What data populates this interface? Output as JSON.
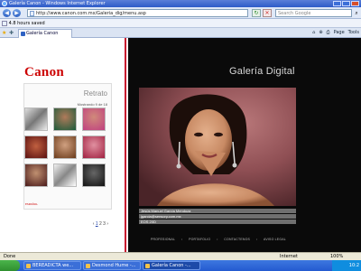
{
  "window": {
    "title": "Galería Canon - Windows Internet Explorer"
  },
  "address": {
    "url": "http://www.canon.com.mx/Galeria_dig/menu.asp",
    "search_placeholder": "Search Google"
  },
  "links_bar": {
    "text": "4.8 hours saved"
  },
  "tab": {
    "label": "Galería Canon"
  },
  "toolbar": {
    "home": "⌂",
    "feed": "⊕",
    "print": "⎙",
    "page": "Page",
    "tools": "Tools"
  },
  "left": {
    "logo": "Canon",
    "album_title": "Retrato",
    "album_subtitle": "Mostrando 9 de 18",
    "pager": {
      "prev": "‹",
      "current": "1",
      "next": "2",
      "after": "3",
      "next_arrow": "›"
    },
    "footer": "ESPAÑOL"
  },
  "right": {
    "title": "Galería Digital",
    "caption_name": "Jesús Manuel García Mendoza",
    "caption_email": "jgarcia@sensory.com.mx",
    "caption_camera": "EOS 20D",
    "nav": [
      "PROFESIONAL",
      "PORTAFOLIO",
      "CONTACTENOS",
      "AVISO LEGAL"
    ]
  },
  "status": {
    "text": "Done",
    "zone": "Internet",
    "zoom": "100%"
  },
  "taskbar": {
    "tasks": [
      "BEREADICTA we...",
      "Desmond Hume -...",
      "Galería Canon -..."
    ],
    "clock": "10:2"
  },
  "colors": {
    "canon_red": "#cc0000",
    "accent_line": "#c8102e",
    "dark_bg": "#0a0a0a"
  }
}
